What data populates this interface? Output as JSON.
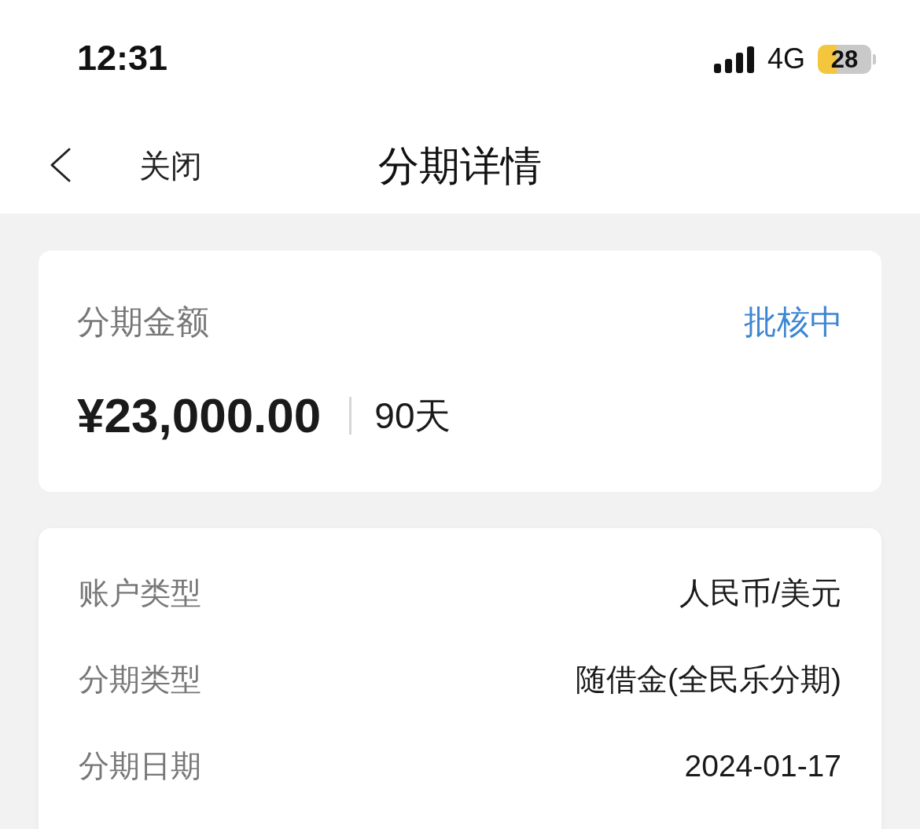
{
  "status_bar": {
    "time": "12:31",
    "network": "4G",
    "battery": "28"
  },
  "nav_bar": {
    "close_label": "关闭",
    "title": "分期详情"
  },
  "amount_card": {
    "label": "分期金额",
    "status": "批核中",
    "amount": "¥23,000.00",
    "term": "90天"
  },
  "details": {
    "rows": [
      {
        "label": "账户类型",
        "value": "人民币/美元"
      },
      {
        "label": "分期类型",
        "value": "随借金(全民乐分期)"
      },
      {
        "label": "分期日期",
        "value": "2024-01-17"
      }
    ]
  }
}
